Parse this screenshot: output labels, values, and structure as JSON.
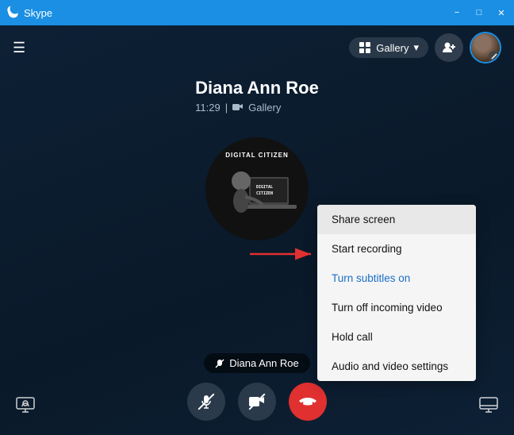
{
  "titlebar": {
    "title": "Skype",
    "icon": "S",
    "controls": {
      "minimize": "−",
      "maximize": "□",
      "close": "✕"
    }
  },
  "topbar": {
    "gallery_label": "Gallery",
    "gallery_arrow": "▾"
  },
  "call": {
    "contact_name": "Diana Ann Roe",
    "status_time": "11:29",
    "status_label": "Gallery"
  },
  "avatar": {
    "label": "DIGITAL CITIZEN"
  },
  "bottom": {
    "name_badge": "Diana Ann Roe"
  },
  "dropdown": {
    "items": [
      {
        "label": "Share screen",
        "highlighted": true,
        "blue": false
      },
      {
        "label": "Start recording",
        "highlighted": false,
        "blue": false
      },
      {
        "label": "Turn subtitles on",
        "highlighted": false,
        "blue": true
      },
      {
        "label": "Turn off incoming video",
        "highlighted": false,
        "blue": false
      },
      {
        "label": "Hold call",
        "highlighted": false,
        "blue": false
      },
      {
        "label": "Audio and video settings",
        "highlighted": false,
        "blue": false
      }
    ]
  }
}
